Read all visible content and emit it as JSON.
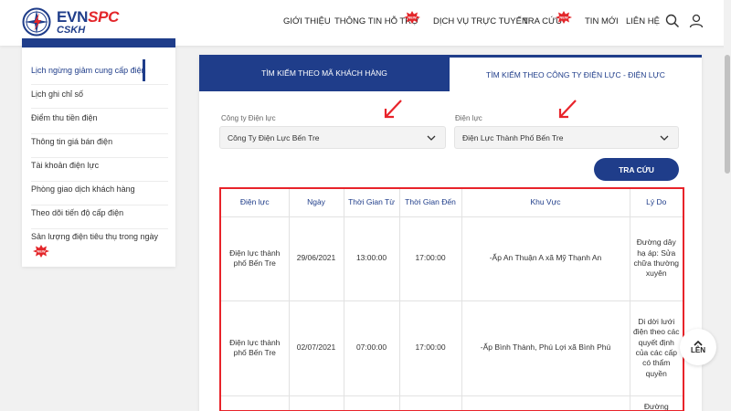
{
  "brand": {
    "name_part1": "EVN",
    "name_part2": "SPC",
    "subtitle": "CSKH"
  },
  "nav": {
    "items": [
      {
        "label": "GIỚI THIỆU",
        "badge": false
      },
      {
        "label": "THÔNG TIN HỖ TRỢ",
        "badge": true
      },
      {
        "label": "DỊCH VỤ TRỰC TUYẾN",
        "badge": false
      },
      {
        "label": "TRA CỨU",
        "badge": true
      },
      {
        "label": "TIN MỚI",
        "badge": false
      },
      {
        "label": "LIÊN HỆ",
        "badge": false
      }
    ],
    "search_icon": "search-icon",
    "user_icon": "user-icon"
  },
  "sidebar": {
    "items": [
      {
        "label": "Lịch ngừng giảm cung cấp điện",
        "active": true
      },
      {
        "label": "Lịch ghi chỉ số"
      },
      {
        "label": "Điểm thu tiền điện"
      },
      {
        "label": "Thông tin giá bán điện"
      },
      {
        "label": "Tài khoản điện lực"
      },
      {
        "label": "Phòng giao dịch khách hàng"
      },
      {
        "label": "Theo dõi tiến độ cấp điện"
      },
      {
        "label": "Sản lượng điện tiêu thụ trong ngày",
        "badge": true
      }
    ]
  },
  "tabs": [
    {
      "label": "TÌM KIẾM THEO MÃ KHÁCH HÀNG",
      "active": true
    },
    {
      "label": "TÌM KIẾM THEO CÔNG TY ĐIỆN LỰC - ĐIỆN LỰC",
      "active": false
    }
  ],
  "filters": {
    "company_label": "Công ty Điện lực",
    "company_value": "Công Ty Điện Lực Bến Tre",
    "branch_label": "Điện lực",
    "branch_value": "Điện Lực Thành Phố Bến Tre",
    "search_button": "TRA CỨU"
  },
  "table": {
    "headers": [
      "Điện lực",
      "Ngày",
      "Thời Gian Từ",
      "Thời Gian Đến",
      "Khu Vực",
      "Lý Do"
    ],
    "rows": [
      {
        "dien_luc": "Điện lực thành phố Bến Tre",
        "ngay": "29/06/2021",
        "tu": "13:00:00",
        "den": "17:00:00",
        "khu_vuc": "-Ấp An Thuận A xã Mỹ Thạnh An",
        "ly_do": "Đường dây hạ áp: Sửa chữa thường xuyên"
      },
      {
        "dien_luc": "Điện lực thành phố Bến Tre",
        "ngay": "02/07/2021",
        "tu": "07:00:00",
        "den": "17:00:00",
        "khu_vuc": "-Ấp Bình Thành, Phú Lợi xã Bình Phú",
        "ly_do": "Di dời lưới điện theo các quyết định của các cấp có thẩm quyền"
      },
      {
        "dien_luc": "",
        "ngay": "",
        "tu": "",
        "den": "",
        "khu_vuc": "",
        "ly_do": "Đường"
      }
    ]
  },
  "back_to_top": {
    "label": "LÊN"
  },
  "colors": {
    "brand_blue": "#1f3d8a",
    "highlight_red": "#e8232a",
    "badge_red": "#e3262a"
  }
}
